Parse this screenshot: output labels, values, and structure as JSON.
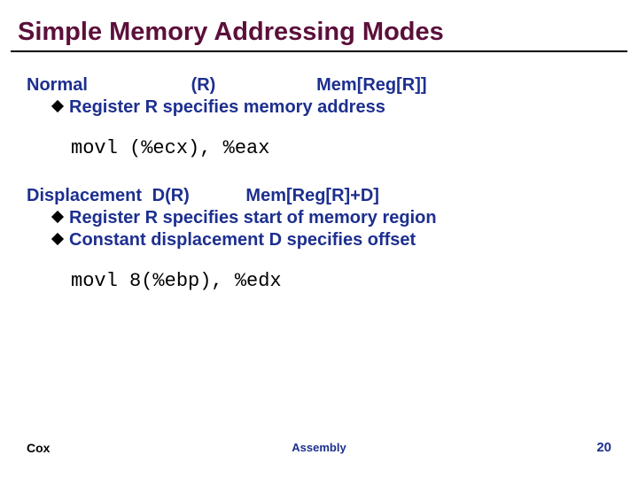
{
  "title": "Simple Memory Addressing Modes",
  "mode1": {
    "name": "Normal",
    "syntax": "(R)",
    "meaning": "Mem[Reg[R]]",
    "bullet1": "Register R specifies memory address",
    "code": "movl (%ecx), %eax"
  },
  "mode2": {
    "name": "Displacement",
    "syntax": "D(R)",
    "meaning": "Mem[Reg[R]+D]",
    "bullet1": "Register R specifies start of memory region",
    "bullet2": "Constant displacement D specifies offset",
    "code": "movl 8(%ebp), %edx"
  },
  "footer": {
    "left": "Cox",
    "center": "Assembly",
    "right": "20"
  }
}
